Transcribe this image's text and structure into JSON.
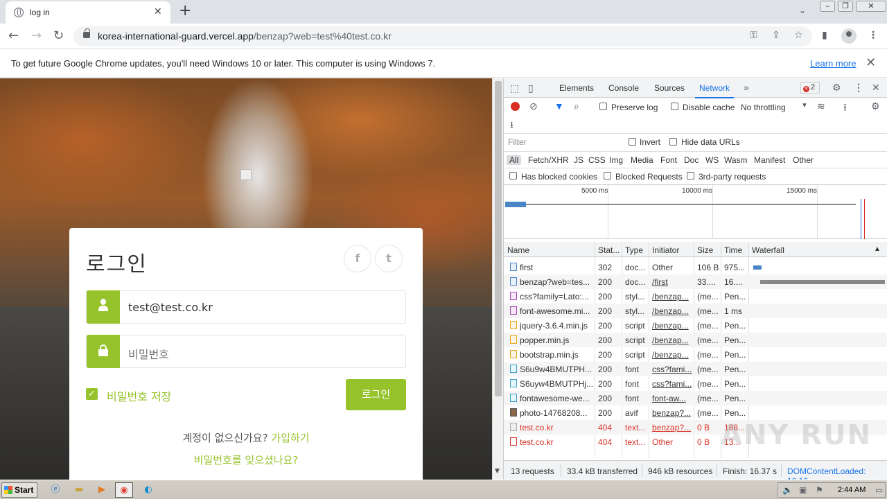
{
  "browser": {
    "tab_title": "log in",
    "url_host": "korea-international-guard.vercel.app",
    "url_path": "/benzap?web=test%40test.co.kr"
  },
  "infobar": {
    "message": "To get future Google Chrome updates, you'll need Windows 10 or later. This computer is using Windows 7.",
    "learn_more": "Learn more"
  },
  "login": {
    "heading": "로그인",
    "email_value": "test@test.co.kr",
    "password_placeholder": "비밀번호",
    "remember_label": "비밀번호 저장",
    "login_button": "로그인",
    "no_account": "계정이 없으신가요?",
    "signup_link": "가입하기",
    "forgot_link": "비밀번호를 잊으셨나요?",
    "social": {
      "facebook": "f",
      "twitter": "t"
    }
  },
  "devtools": {
    "tabs": [
      "Elements",
      "Console",
      "Sources",
      "Network"
    ],
    "active_tab": "Network",
    "error_count": "2",
    "preserve_log": "Preserve log",
    "disable_cache": "Disable cache",
    "throttling": "No throttling",
    "filter_placeholder": "Filter",
    "invert": "Invert",
    "hide_data_urls": "Hide data URLs",
    "filter_types": [
      "All",
      "Fetch/XHR",
      "JS",
      "CSS",
      "Img",
      "Media",
      "Font",
      "Doc",
      "WS",
      "Wasm",
      "Manifest",
      "Other"
    ],
    "has_blocked_cookies": "Has blocked cookies",
    "blocked_requests": "Blocked Requests",
    "third_party": "3rd-party requests",
    "overview_ticks": [
      "5000 ms",
      "10000 ms",
      "15000 ms"
    ],
    "columns": [
      "Name",
      "Stat...",
      "Type",
      "Initiator",
      "Size",
      "Time",
      "Waterfall"
    ],
    "requests": [
      {
        "name": "first",
        "status": "302",
        "type": "doc...",
        "initiator": "Other",
        "size": "106 B",
        "time": "975...",
        "icon": "doc"
      },
      {
        "name": "benzap?web=tes...",
        "status": "200",
        "type": "doc...",
        "initiator": "/first",
        "size": "33....",
        "time": "16....",
        "icon": "doc"
      },
      {
        "name": "css?family=Lato:...",
        "status": "200",
        "type": "styl...",
        "initiator": "/benzap...",
        "size": "(me...",
        "time": "Pen...",
        "icon": "css"
      },
      {
        "name": "font-awesome.mi...",
        "status": "200",
        "type": "styl...",
        "initiator": "/benzap...",
        "size": "(me...",
        "time": "1 ms",
        "icon": "css"
      },
      {
        "name": "jquery-3.6.4.min.js",
        "status": "200",
        "type": "script",
        "initiator": "/benzap...",
        "size": "(me...",
        "time": "Pen...",
        "icon": "js"
      },
      {
        "name": "popper.min.js",
        "status": "200",
        "type": "script",
        "initiator": "/benzap...",
        "size": "(me...",
        "time": "Pen...",
        "icon": "js"
      },
      {
        "name": "bootstrap.min.js",
        "status": "200",
        "type": "script",
        "initiator": "/benzap...",
        "size": "(me...",
        "time": "Pen...",
        "icon": "js"
      },
      {
        "name": "S6u9w4BMUTPH...",
        "status": "200",
        "type": "font",
        "initiator": "css?fami...",
        "size": "(me...",
        "time": "Pen...",
        "icon": "font"
      },
      {
        "name": "S6uyw4BMUTPHj...",
        "status": "200",
        "type": "font",
        "initiator": "css?fami...",
        "size": "(me...",
        "time": "Pen...",
        "icon": "font"
      },
      {
        "name": "fontawesome-we...",
        "status": "200",
        "type": "font",
        "initiator": "font-aw...",
        "size": "(me...",
        "time": "Pen...",
        "icon": "font"
      },
      {
        "name": "photo-14768208...",
        "status": "200",
        "type": "avif",
        "initiator": "benzap?...",
        "size": "(me...",
        "time": "Pen...",
        "icon": "img"
      },
      {
        "name": "test.co.kr",
        "status": "404",
        "type": "text...",
        "initiator": "benzap?...",
        "size": "0 B",
        "time": "188...",
        "icon": "txt"
      },
      {
        "name": "test.co.kr",
        "status": "404",
        "type": "text...",
        "initiator": "Other",
        "size": "0 B",
        "time": "13...",
        "icon": "err"
      }
    ],
    "summary": {
      "requests": "13 requests",
      "transferred": "33.4 kB transferred",
      "resources": "946 kB resources",
      "finish": "Finish: 16.37 s",
      "dcl": "DOMContentLoaded: 16.16"
    }
  },
  "taskbar": {
    "start": "Start",
    "time": "2:44 AM"
  },
  "watermark": "ANY RUN",
  "colors": {
    "accent": "#96c32c",
    "devtools_blue": "#1a73e8",
    "error_red": "#d93025"
  }
}
